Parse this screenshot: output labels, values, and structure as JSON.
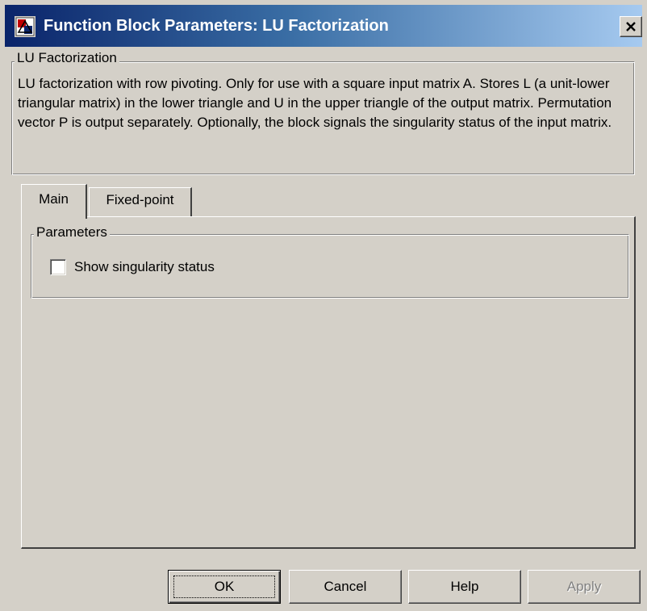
{
  "window": {
    "title": "Function Block Parameters: LU Factorization",
    "title_icon": "simulink-block-icon",
    "close_icon": "close-icon"
  },
  "description_group": {
    "legend": "LU Factorization",
    "text": "LU factorization with row pivoting.  Only for use with a square input matrix A.  Stores L (a unit-lower triangular matrix) in the lower triangle and U in the upper triangle of the output matrix.  Permutation vector P is output separately. Optionally, the block signals the singularity status of the input matrix."
  },
  "tabs": [
    {
      "label": "Main",
      "active": true
    },
    {
      "label": "Fixed-point",
      "active": false
    }
  ],
  "parameters_group": {
    "legend": "Parameters",
    "show_singularity": {
      "label": "Show singularity status",
      "checked": false
    }
  },
  "buttons": {
    "ok": "OK",
    "cancel": "Cancel",
    "help": "Help",
    "apply": "Apply",
    "apply_enabled": false
  },
  "colors": {
    "face": "#d4d0c8",
    "title_start": "#0a246a",
    "title_end": "#a6caf0",
    "disabled_text": "#808080"
  }
}
